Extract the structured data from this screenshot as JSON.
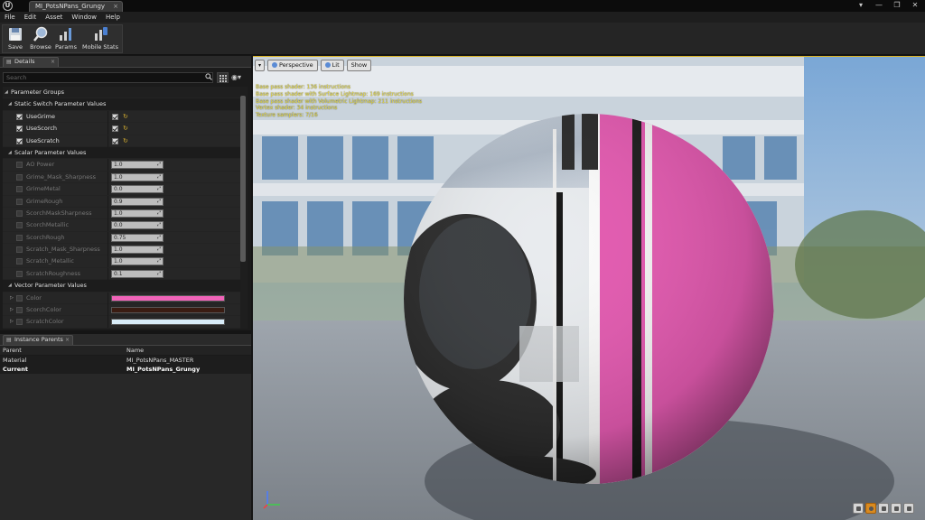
{
  "window": {
    "logo": "U",
    "tab_title": "MI_PotsNPans_Grungy",
    "tab_close": "×",
    "controls": [
      "▾",
      "—",
      "❐",
      "✕"
    ]
  },
  "menu": [
    "File",
    "Edit",
    "Asset",
    "Window",
    "Help"
  ],
  "toolbar": {
    "save": "Save",
    "browse": "Browse",
    "params": "Params",
    "mobile_stats": "Mobile Stats"
  },
  "details": {
    "tab_label": "Details",
    "tab_close": "×",
    "search_placeholder": "Search",
    "eye_glyph": "◉▾",
    "parameter_groups": "Parameter Groups",
    "static_switch_header": "Static Switch Parameter Values",
    "static_switches": [
      {
        "name": "UseGrime",
        "checked": true
      },
      {
        "name": "UseScorch",
        "checked": true
      },
      {
        "name": "UseScratch",
        "checked": true
      }
    ],
    "scalar_header": "Scalar Parameter Values",
    "scalars": [
      {
        "name": "AO Power",
        "value": "1.0"
      },
      {
        "name": "Grime_Mask_Sharpness",
        "value": "1.0"
      },
      {
        "name": "GrimeMetal",
        "value": "0.0"
      },
      {
        "name": "GrimeRough",
        "value": "0.9"
      },
      {
        "name": "ScorchMaskSharpness",
        "value": "1.0"
      },
      {
        "name": "ScorchMetallic",
        "value": "0.0"
      },
      {
        "name": "ScorchRough",
        "value": "0.75"
      },
      {
        "name": "Scratch_Mask_Sharpness",
        "value": "1.0"
      },
      {
        "name": "Scratch_Metallic",
        "value": "1.0"
      },
      {
        "name": "ScratchRoughness",
        "value": "0.1"
      }
    ],
    "vector_header": "Vector Parameter Values",
    "vectors": [
      {
        "name": "Color",
        "color": "#f063b8"
      },
      {
        "name": "ScorchColor",
        "color": "#3a1c12"
      },
      {
        "name": "ScratchColor",
        "color": "#d8ecf8"
      }
    ],
    "reset_glyph": "↻",
    "spin_glyph": "⤢"
  },
  "instance_parents": {
    "tab_label": "Instance Parents",
    "tab_close": "×",
    "headers": {
      "parent": "Parent",
      "name": "Name"
    },
    "rows": [
      {
        "parent": "Material",
        "name": "MI_PotsNPans_MASTER"
      },
      {
        "parent": "Current",
        "name": "MI_PotsNPans_Grungy"
      }
    ]
  },
  "viewport": {
    "menu_glyph": "▾",
    "perspective": "Perspective",
    "lit": "Lit",
    "show": "Show",
    "stats": [
      "Base pass shader: 136 instructions",
      "Base pass shader with Surface Lightmap: 169 instructions",
      "Base pass shader with Volumetric Lightmap: 211 instructions",
      "Vertex shader: 34 instructions",
      "Texture samplers: 7/16"
    ]
  },
  "colors": {
    "accent": "#d8b32a",
    "sphere_pink": "#e35ab0",
    "stats_text": "#f0e44a"
  }
}
